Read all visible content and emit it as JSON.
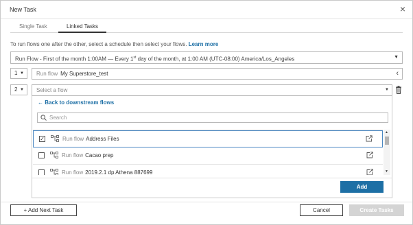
{
  "dialog": {
    "title": "New Task",
    "close_glyph": "×"
  },
  "tabs": [
    {
      "label": "Single Task",
      "active": false
    },
    {
      "label": "Linked Tasks",
      "active": true
    }
  ],
  "intro": {
    "text": "To run flows one after the other, select a schedule then select your flows.",
    "link": "Learn more"
  },
  "schedule": {
    "value_prefix": "Run Flow - First of the month 1:00AM — Every 1",
    "superscript": "st",
    "value_suffix": " day of the month, at 1:00 AM (UTC-08:00) America/Los_Angeles"
  },
  "task_rows": [
    {
      "number": "1",
      "prefix": "Run flow",
      "flow_name": "My Superstore_test"
    },
    {
      "number": "2",
      "placeholder": "Select a flow"
    }
  ],
  "panel": {
    "back_label": "Back to downstream flows",
    "search_placeholder": "Search",
    "items": [
      {
        "prefix": "Run flow",
        "name": "Address Files",
        "checked": true
      },
      {
        "prefix": "Run flow",
        "name": "Cacao prep",
        "checked": false
      },
      {
        "prefix": "Run flow",
        "name": "2019.2.1 dp Athena 887699",
        "checked": false
      }
    ],
    "add_label": "Add"
  },
  "footer": {
    "add_next_label": "+ Add Next Task",
    "cancel_label": "Cancel",
    "create_label": "Create Tasks"
  },
  "colors": {
    "accent": "#1d6fa5",
    "disabled": "#d4d4d4",
    "selected_border": "#4a87c2"
  }
}
